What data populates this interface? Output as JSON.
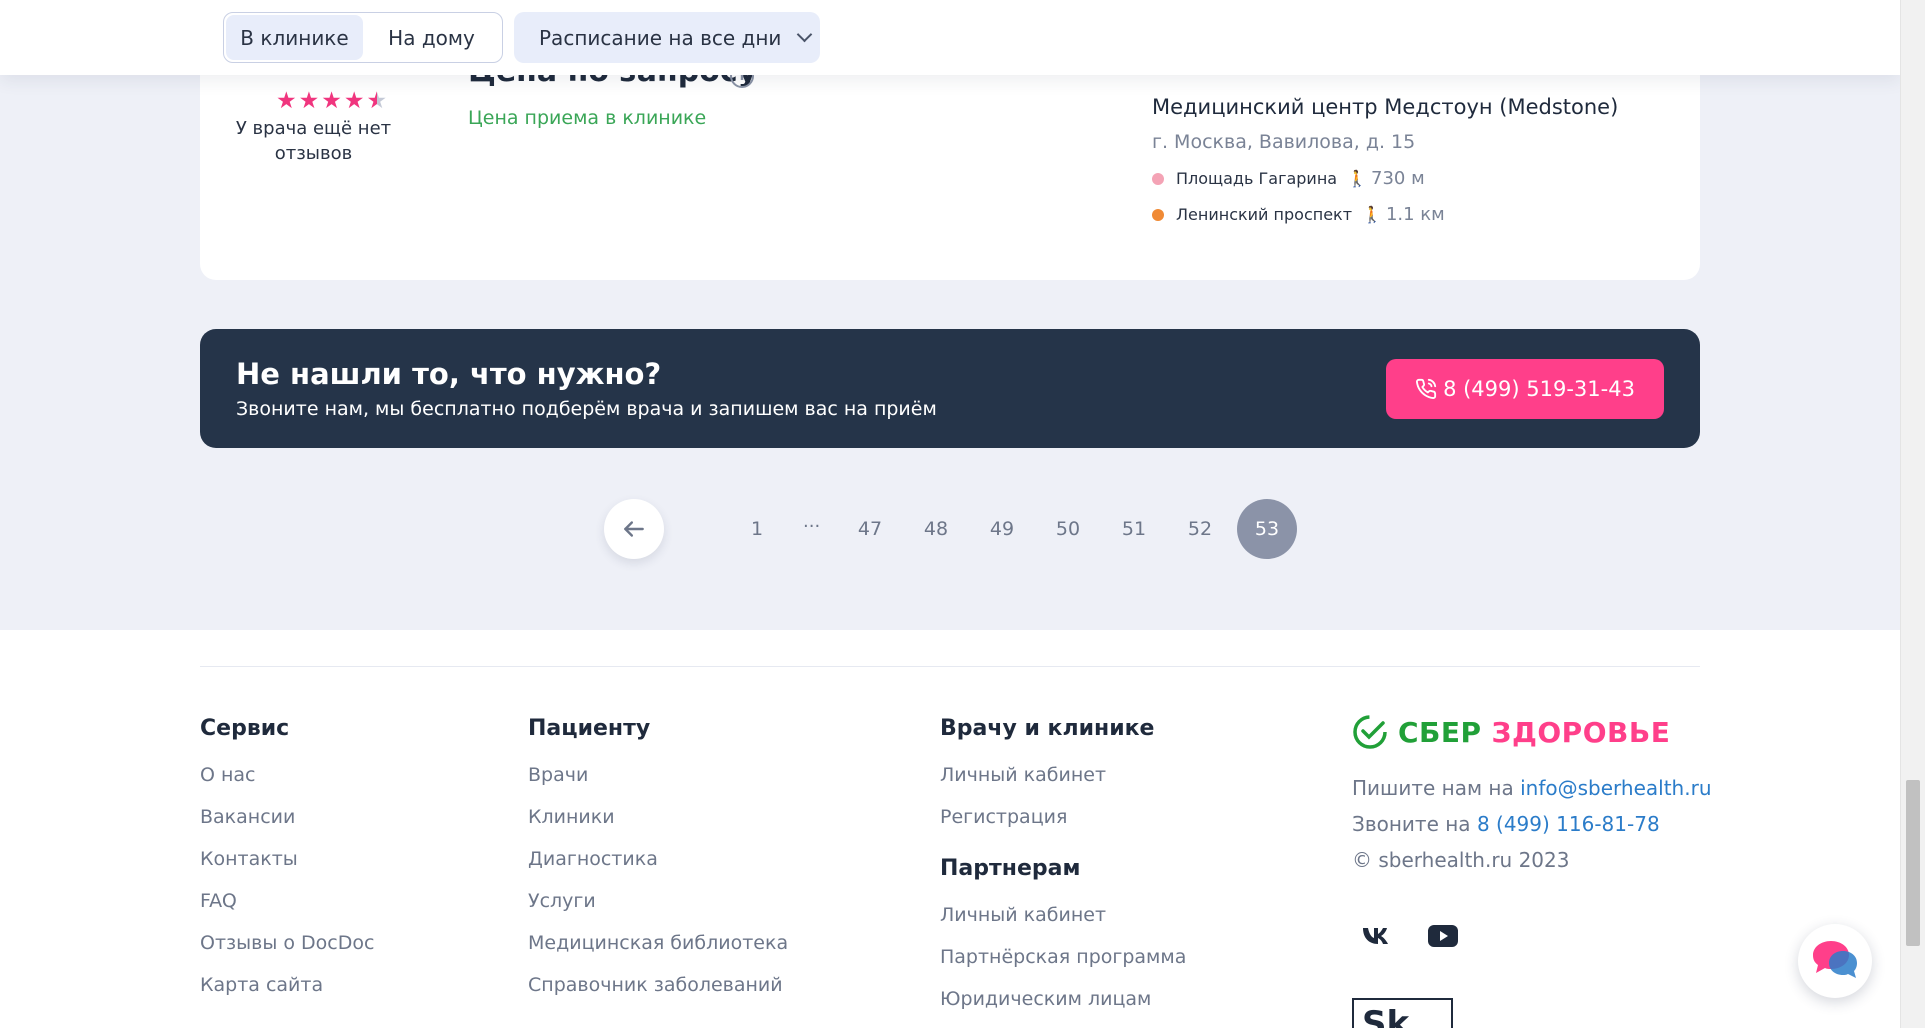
{
  "filters": {
    "tabs": [
      {
        "label": "В клинике",
        "active": true
      },
      {
        "label": "На дому",
        "active": false
      }
    ],
    "schedule_label": "Расписание на все дни"
  },
  "doctor_card": {
    "rating_stars": 4.5,
    "rating_max": 5,
    "no_reviews": "У врача ещё нет отзывов",
    "price_title": "Цена по запросу",
    "price_subtitle": "Цена приема в клинике",
    "clinic": {
      "name": "Медицинский центр Медстоун (Medstone)",
      "address": "г. Москва, Вавилова, д. 15",
      "metro": [
        {
          "name": "Площадь Гагарина",
          "distance": "730 м",
          "color": "#f4a3b5"
        },
        {
          "name": "Ленинский проспект",
          "distance": "1.1 км",
          "color": "#f08a35"
        }
      ]
    }
  },
  "cta": {
    "title": "Не нашли то, что нужно?",
    "subtitle": "Звоните нам, мы бесплатно подберём врача и запишем вас на приём",
    "phone": "8 (499) 519-31-43"
  },
  "pagination": {
    "pages": [
      "1",
      "47",
      "48",
      "49",
      "50",
      "51",
      "52",
      "53"
    ],
    "ellipsis": "...",
    "current": "53"
  },
  "footer": {
    "service": {
      "title": "Сервис",
      "links": [
        "О нас",
        "Вакансии",
        "Контакты",
        "FAQ",
        "Отзывы о DocDoc",
        "Карта сайта"
      ]
    },
    "patient": {
      "title": "Пациенту",
      "links": [
        "Врачи",
        "Клиники",
        "Диагностика",
        "Услуги",
        "Медицинская библиотека",
        "Справочник заболеваний"
      ]
    },
    "doctor": {
      "title": "Врачу и клинике",
      "links": [
        "Личный кабинет",
        "Регистрация"
      ]
    },
    "partners": {
      "title": "Партнерам",
      "links": [
        "Личный кабинет",
        "Партнёрская программа",
        "Юридическим лицам"
      ]
    },
    "brand": {
      "part1": "СБЕР",
      "part2": "ЗДОРОВЬЕ"
    },
    "write_prefix": "Пишите нам на",
    "email": "info@sberhealth.ru",
    "call_prefix": "Звоните на",
    "phone": "8 (499) 116-81-78",
    "copyright": "© sberhealth.ru 2023",
    "sk_logo": "Sk"
  },
  "colors": {
    "accent_pink": "#ff3f8a",
    "dark_banner": "#253449",
    "sber_green": "#21a038",
    "link_blue": "#2b7cc9",
    "price_green": "#3aa657"
  }
}
